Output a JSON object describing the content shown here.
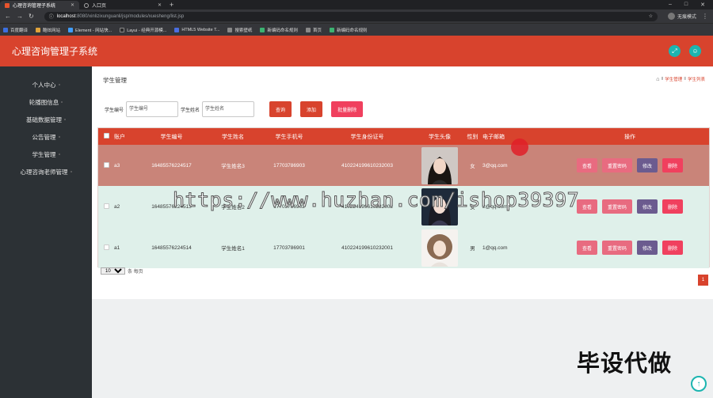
{
  "browser": {
    "tabs": [
      {
        "title": "心理咨询管理子系统",
        "active": true
      },
      {
        "title": "入口页",
        "active": false
      }
    ],
    "new_tab": "+",
    "url_host": "localhost",
    "url_path": ":8080/xinlizixunguanli/jsp/modules/xuesheng/list.jsp",
    "profile_label": "无痕模式",
    "bookmarks": [
      "百度翻译",
      "酷炫网站",
      "Element - 网站快...",
      "Layui - 经典开源模...",
      "HTML5 Website T...",
      "搜索壁纸",
      "新编码命名规则",
      "首页",
      "新编码命名规则"
    ]
  },
  "app": {
    "title": "心理咨询管理子系统"
  },
  "sidebar": {
    "items": [
      "个人中心",
      "轮播图信息",
      "基础数据管理",
      "公告管理",
      "学生管理",
      "心理咨询老师管理"
    ]
  },
  "page": {
    "title": "学生管理",
    "breadcrumb": [
      "学生管理",
      "学生列表"
    ]
  },
  "search": {
    "label_id": "学生编号",
    "placeholder_id": "学生编号",
    "label_name": "学生姓名",
    "placeholder_name": "学生姓名",
    "query": "查询",
    "add": "添加",
    "batch_delete": "批量删除"
  },
  "table": {
    "headers": [
      "账户",
      "学生编号",
      "学生姓名",
      "学生手机号",
      "学生身份证号",
      "学生头像",
      "性别",
      "电子邮箱",
      "操作"
    ],
    "rows": [
      {
        "account": "a3",
        "id": "16485576224517",
        "name": "学生姓名3",
        "phone": "17703786903",
        "idcard": "410224199610232003",
        "gender": "女",
        "email": "3@qq.com"
      },
      {
        "account": "a2",
        "id": "16485576224513",
        "name": "学生姓名2",
        "phone": "17703786902",
        "idcard": "410224199610232002",
        "gender": "女",
        "email": "2@qq.com"
      },
      {
        "account": "a1",
        "id": "16485576224514",
        "name": "学生姓名1",
        "phone": "17703786901",
        "idcard": "410224199610232001",
        "gender": "男",
        "email": "1@qq.com"
      }
    ],
    "actions": {
      "view": "查看",
      "reset": "重置密码",
      "edit": "修改",
      "delete": "删除"
    }
  },
  "pager": {
    "page_size": "10",
    "per_page_label": "条 每页",
    "current_page": "1"
  },
  "overlay": {
    "watermark": "https://www.huzhan.com/ishop39397",
    "promo": "毕设代做"
  },
  "colors": {
    "header": "#d8432d",
    "sidebar": "#2c3135",
    "accent_teal": "#1cb5b0",
    "selected_row": "#c98479",
    "row": "#dff0ea"
  }
}
